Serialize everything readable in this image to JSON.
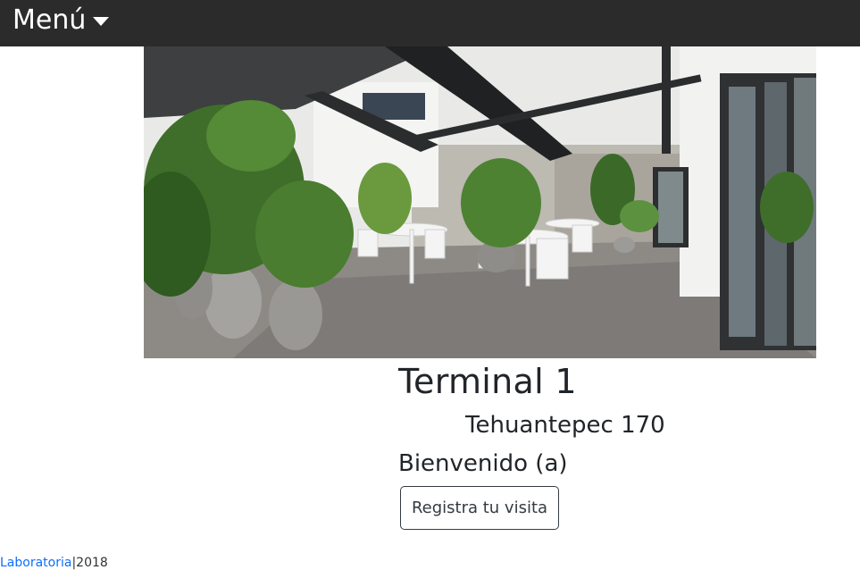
{
  "navbar": {
    "menu_label": "Menú",
    "menu_icon": "caret-down-icon"
  },
  "hero": {
    "image_subject": "terrace-with-plants-photo"
  },
  "main": {
    "title": "Terminal 1",
    "address": "Tehuantepec 170",
    "welcome": "Bienvenido (a)",
    "register_button_label": "Registra tu visita"
  },
  "footer": {
    "link_text": "Laboratoria",
    "separator": "|",
    "year": "2018"
  },
  "colors": {
    "navbar_bg": "#2b2b2b",
    "link": "#0d6efd",
    "button_border": "#343a40"
  }
}
